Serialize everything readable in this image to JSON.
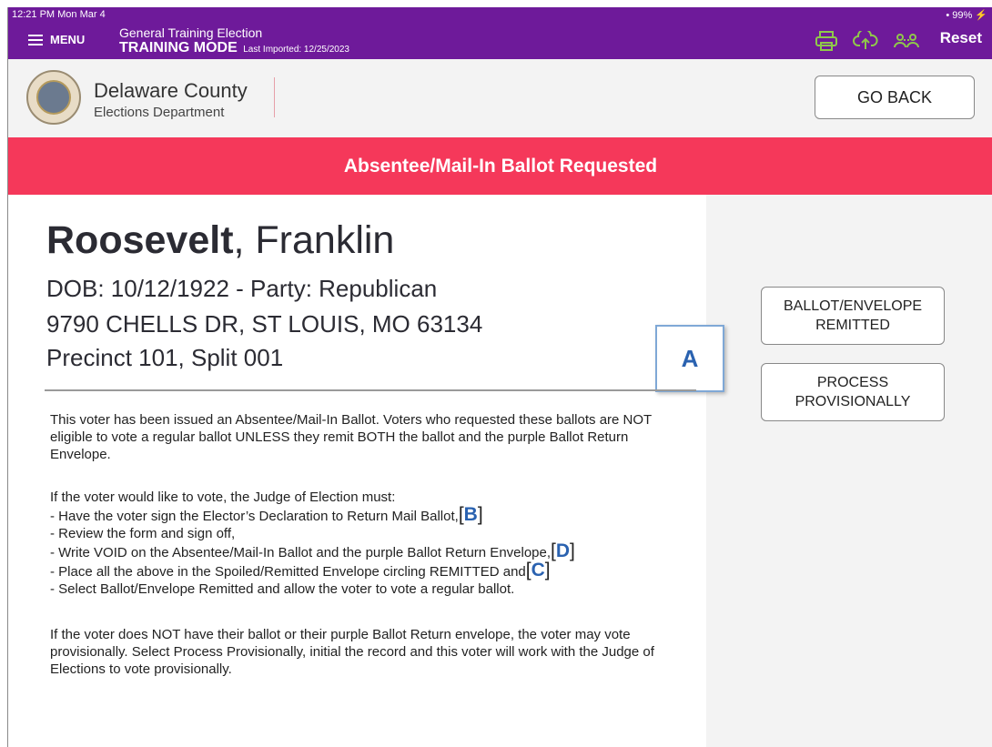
{
  "status": {
    "time": "12:21 PM  Mon Mar 4",
    "battery": "• 99% ⚡"
  },
  "topbar": {
    "menu_label": "MENU",
    "election_title": "General Training Election",
    "mode": "TRAINING MODE",
    "last_imported": "Last Imported: 12/25/2023",
    "reset_label": "Reset",
    "icons": [
      "printer-icon",
      "cloud-upload-icon",
      "users-icon"
    ]
  },
  "header": {
    "org_name": "Delaware County",
    "org_dept": "Elections Department",
    "go_back_label": "GO BACK"
  },
  "banner": {
    "text": "Absentee/Mail-In Ballot Requested"
  },
  "voter": {
    "last_name": "Roosevelt",
    "first_name": ", Franklin",
    "dob_party": "DOB: 10/12/1922 - Party: Republican",
    "address": "9790 CHELLS DR, ST LOUIS, MO 63134",
    "precinct": "Precinct 101, Split 001"
  },
  "annotation_a": "A",
  "actions": {
    "remitted_line1": "BALLOT/ENVELOPE",
    "remitted_line2": "REMITTED",
    "provisional_line1": "PROCESS",
    "provisional_line2": "PROVISIONALLY"
  },
  "instructions": {
    "para1": "This voter has been issued an Absentee/Mail-In Ballot. Voters who requested these ballots are NOT eligible to vote a regular ballot UNLESS they remit BOTH the ballot and the purple Ballot Return Envelope.",
    "intro": "If the voter would like to vote, the Judge of Election must:",
    "steps": [
      "- Have the voter sign the Elector’s Declaration to Return Mail Ballot,",
      "- Review the form and sign off,",
      "- Write VOID on the Absentee/Mail-In Ballot and the purple Ballot Return Envelope,",
      "- Place all the above in the Spoiled/Remitted Envelope circling REMITTED and",
      "-  Select Ballot/Envelope Remitted and allow the voter to vote a regular ballot."
    ],
    "step_tags": [
      "B",
      "",
      "D",
      "C",
      ""
    ],
    "para3": "If the voter does NOT have their ballot or their purple Ballot Return envelope, the voter may vote provisionally.  Select Process Provisionally, initial the record and this voter will work with the Judge of Elections to vote provisionally."
  },
  "colors": {
    "topbar": "#6e1a9a",
    "banner": "#f5385a",
    "annotation": "#2a62b0"
  }
}
